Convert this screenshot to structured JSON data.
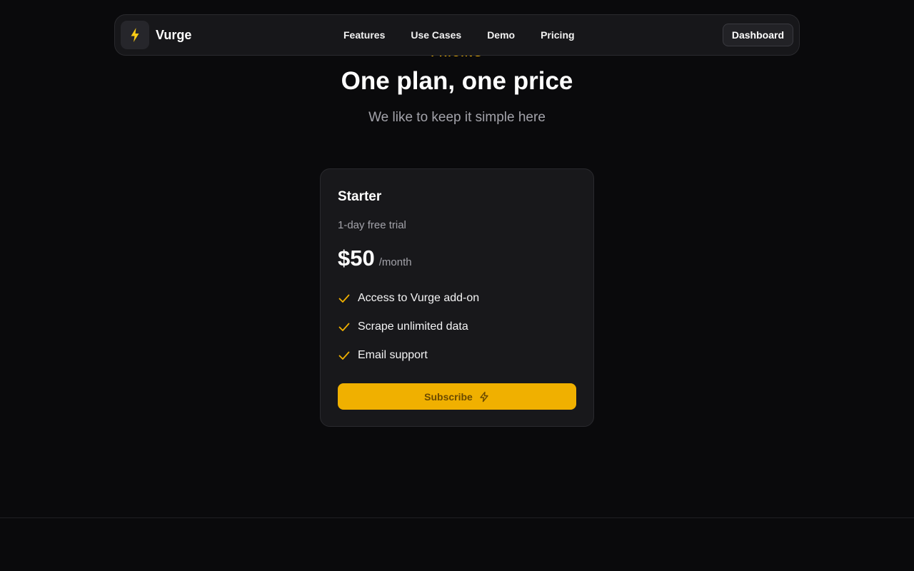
{
  "accent_color": "#f0b000",
  "background_color": "#0a0a0c",
  "navbar": {
    "brand_name": "Vurge",
    "logo_icon": "lightning-bolt-icon",
    "links": [
      {
        "label": "Features"
      },
      {
        "label": "Use Cases"
      },
      {
        "label": "Demo"
      },
      {
        "label": "Pricing"
      }
    ],
    "dashboard_label": "Dashboard"
  },
  "hero": {
    "eyebrow": "PRICING",
    "title": "One plan, one price",
    "subtitle": "We like to keep it simple here"
  },
  "plan": {
    "name": "Starter",
    "trial": "1-day free trial",
    "price": "$50",
    "period": "/month",
    "features": [
      {
        "text": "Access to Vurge add-on",
        "icon": "check-icon"
      },
      {
        "text": "Scrape unlimited data",
        "icon": "check-icon"
      },
      {
        "text": "Email support",
        "icon": "check-icon"
      }
    ],
    "subscribe_label": "Subscribe",
    "subscribe_icon": "lightning-outline-icon"
  }
}
